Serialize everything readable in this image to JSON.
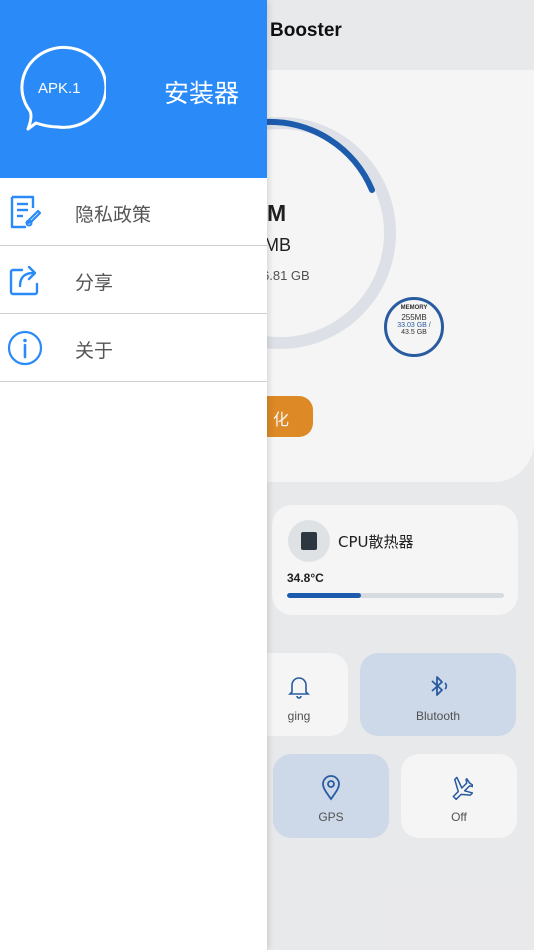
{
  "app": {
    "title": "Booster",
    "ram_big": "M",
    "ram_mid": "MB",
    "ram_small": "6.81 GB",
    "memory": {
      "label": "MEMORY",
      "used": "255MB",
      "free": "33.03 GB /",
      "total": "43.5 GB"
    },
    "optimize_label": "化",
    "cpu": {
      "label": "CPU散热器",
      "temp": "34.8°C",
      "level_percent": 34
    },
    "tiles": {
      "charging": "ging",
      "bluetooth": "Blutooth",
      "gps": "GPS",
      "airplane": "Off"
    },
    "colors": {
      "accent": "#2a8af8",
      "gauge": "#1f5fb3",
      "optimize": "#e58f28",
      "active_tile": "#d6e2f2"
    }
  },
  "drawer": {
    "logo_text": "APK.1",
    "title": "安装器",
    "items": [
      {
        "label": "隐私政策",
        "icon": "document-edit-icon"
      },
      {
        "label": "分享",
        "icon": "share-icon"
      },
      {
        "label": "关于",
        "icon": "info-icon"
      }
    ]
  }
}
